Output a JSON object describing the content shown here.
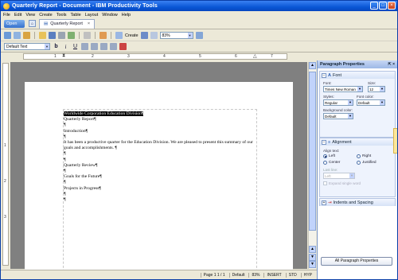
{
  "window": {
    "title": "Quarterly Report - Document - IBM Productivity Tools"
  },
  "menu": [
    "File",
    "Edit",
    "View",
    "Create",
    "Tools",
    "Table",
    "Layout",
    "Window",
    "Help"
  ],
  "tabs": {
    "open_label": "Open",
    "doc_tab": "Quarterly Report"
  },
  "toolbar": {
    "create_label": "Create",
    "zoom": "83%"
  },
  "format": {
    "style": "Default Text",
    "bold": "b",
    "italic": "i",
    "underline": "U"
  },
  "ruler": {
    "marks": [
      "1",
      "2",
      "3",
      "4",
      "5",
      "6",
      "7"
    ]
  },
  "vruler": {
    "marks": [
      "1",
      "2",
      "3"
    ]
  },
  "document": {
    "lines": [
      "Worldwide Corporation Education Division¶",
      "Quarterly Report¶",
      "¶",
      "Introduction¶",
      "¶",
      "It has been a productive quarter for the Education Division. We are pleased to present this summary of our goals and accomplishments. ¶",
      "¶",
      "¶",
      "Quarterly Review¶",
      "¶",
      "Goals for the Future¶",
      "¶",
      "Projects in Progress¶",
      "¶",
      "¶"
    ]
  },
  "status": {
    "page": "Page 1  1 / 1",
    "style": "Default",
    "zoom": "83%",
    "insert": "INSERT",
    "std": "STD",
    "hyp": "HYP"
  },
  "panel": {
    "title": "Paragraph Properties",
    "font": {
      "header": "Font",
      "font_label": "Font:",
      "font_value": "Times New Roman",
      "size_label": "Size:",
      "size_value": "12",
      "styles_label": "Styles:",
      "styles_value": "Regular",
      "color_label": "Font color:",
      "color_value": "Default",
      "bg_label": "Background color:",
      "bg_value": "Default"
    },
    "alignment": {
      "header": "Alignment",
      "align_label": "Align text:",
      "left": "Left",
      "right": "Right",
      "center": "Center",
      "justified": "Justified",
      "last_line_label": "Last line:",
      "last_line_value": "Left",
      "expand": "Expand single word"
    },
    "indents": {
      "header": "Indents and Spacing"
    },
    "all_button": "All Paragraph Properties"
  }
}
